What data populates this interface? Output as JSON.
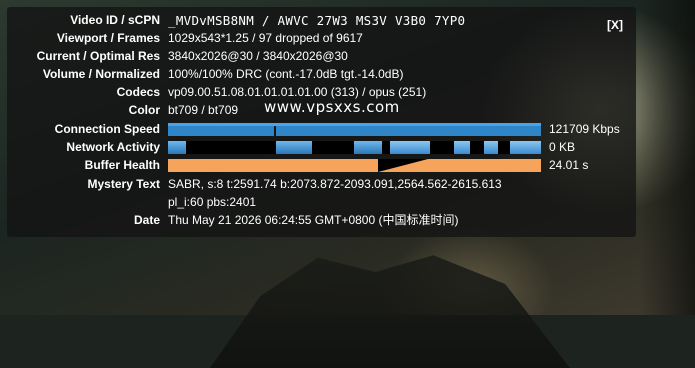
{
  "overlay": {
    "close_label": "[X]",
    "rows": {
      "video_id": {
        "label": "Video ID / sCPN",
        "value": "_MVDvMSB8NM / AWVC 27W3 MS3V V3B0 7YP0"
      },
      "viewport": {
        "label": "Viewport / Frames",
        "value": "1029x543*1.25 / 97 dropped of 9617"
      },
      "resolution": {
        "label": "Current / Optimal Res",
        "value": "3840x2026@30 / 3840x2026@30"
      },
      "volume": {
        "label": "Volume / Normalized",
        "value": "100%/100% DRC (cont.-17.0dB tgt.-14.0dB)"
      },
      "codecs": {
        "label": "Codecs",
        "value": "vp09.00.51.08.01.01.01.01.00 (313) / opus (251)"
      },
      "color": {
        "label": "Color",
        "value": "bt709 / bt709",
        "watermark": "www.vpsxxs.com"
      },
      "connection_speed": {
        "label": "Connection Speed",
        "value": "121709 Kbps"
      },
      "network_activity": {
        "label": "Network Activity",
        "value": "0 KB"
      },
      "buffer_health": {
        "label": "Buffer Health",
        "value": "24.01 s"
      },
      "mystery_text": {
        "label": "Mystery Text",
        "line1": "SABR, s:8 t:2591.74 b:2073.872-2093.091,2564.562-2615.613",
        "line2": "pl_i:60 pbs:2401"
      },
      "date": {
        "label": "Date",
        "value": "Thu May 21 2026 06:24:55 GMT+0800 (中国标准时间)"
      }
    }
  },
  "colors": {
    "connection_bar": "#2e86c9",
    "network_bar": "#4a9fe0",
    "buffer_bar": "#f6a35c",
    "graph_bg": "#000000"
  }
}
